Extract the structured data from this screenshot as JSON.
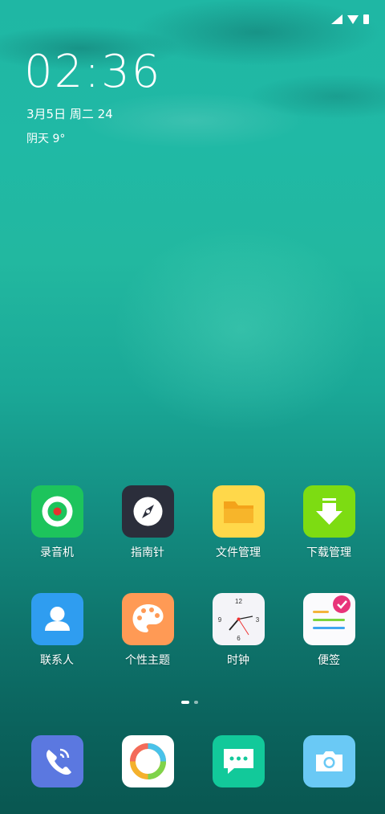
{
  "status_bar": {
    "icons": [
      "signal-icon",
      "wifi-icon",
      "battery-icon"
    ]
  },
  "lockscreen": {
    "time": "02:36",
    "date": "3月5日 周二  24",
    "weather": "阴天  9°"
  },
  "apps": {
    "row1": [
      {
        "label": "录音机",
        "icon": "recorder-icon",
        "color": "#1dc45c"
      },
      {
        "label": "指南针",
        "icon": "compass-icon",
        "color": "#2b2e3b"
      },
      {
        "label": "文件管理",
        "icon": "folder-icon",
        "color": "#ffd84a"
      },
      {
        "label": "下载管理",
        "icon": "download-icon",
        "color": "#7ddc12"
      }
    ],
    "row2": [
      {
        "label": "联系人",
        "icon": "contacts-icon",
        "color": "#2f9df0"
      },
      {
        "label": "个性主题",
        "icon": "theme-palette-icon",
        "color": "#ff9a55"
      },
      {
        "label": "时钟",
        "icon": "clock-icon",
        "color": "#f4f4f8"
      },
      {
        "label": "便签",
        "icon": "notes-icon",
        "color": "#fbfbfd"
      }
    ]
  },
  "clock_face": {
    "n12": "12",
    "n3": "3",
    "n6": "6",
    "n9": "9"
  },
  "dock": [
    {
      "icon": "phone-icon",
      "color": "#5b78e0"
    },
    {
      "icon": "browser-icon",
      "color": "#ffffff"
    },
    {
      "icon": "messages-icon",
      "color": "#12c99a"
    },
    {
      "icon": "camera-icon",
      "color": "#6ac9f5"
    }
  ]
}
